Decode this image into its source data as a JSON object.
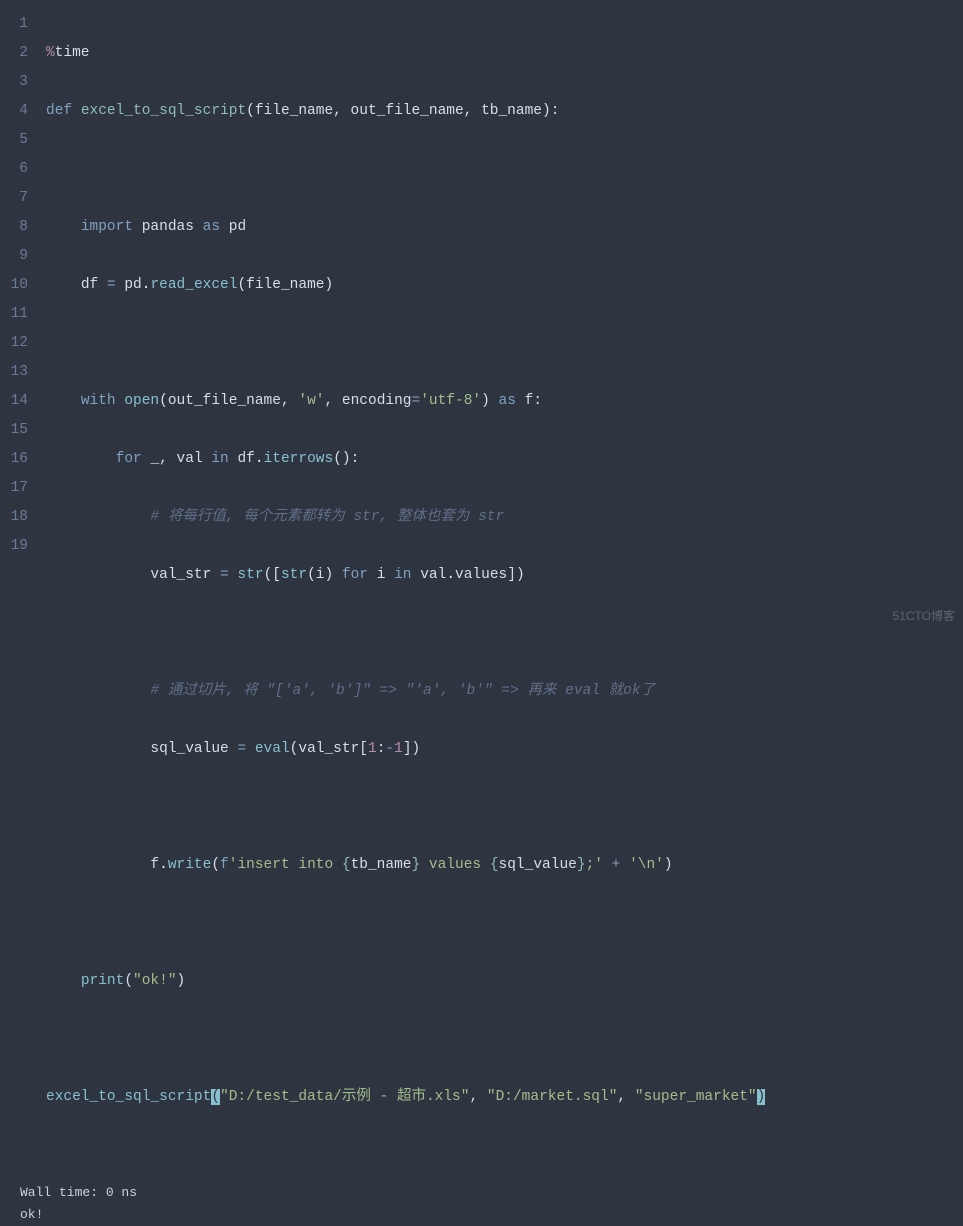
{
  "gutter": [
    "1",
    "2",
    "3",
    "4",
    "5",
    "6",
    "7",
    "8",
    "9",
    "10",
    "11",
    "12",
    "13",
    "14",
    "15",
    "16",
    "17",
    "18",
    "19"
  ],
  "code": {
    "l1_magic": "%",
    "l1_time": "time",
    "l2_def": "def",
    "l2_name": "excel_to_sql_script",
    "l2_params": "(file_name, out_file_name, tb_name):",
    "l4_import": "import",
    "l4_pandas": "pandas",
    "l4_as": "as",
    "l4_pd": "pd",
    "l5_df": "df",
    "l5_eq": "=",
    "l5_pd": "pd",
    "l5_dot": ".",
    "l5_read": "read_excel",
    "l5_arg": "(file_name)",
    "l7_with": "with",
    "l7_open": "open",
    "l7_args1": "(out_file_name, ",
    "l7_w": "'w'",
    "l7_comma": ", encoding",
    "l7_eq": "=",
    "l7_utf": "'utf-8'",
    "l7_close": ")",
    "l7_as": "as",
    "l7_f": "f:",
    "l8_for": "for",
    "l8_uscore": "_, val",
    "l8_in": "in",
    "l8_df": "df",
    "l8_dot": ".",
    "l8_iter": "iterrows",
    "l8_paren": "():",
    "l9_cmt": "# 将每行值, 每个元素都转为 str, 整体也套为 str",
    "l10_valstr": "val_str",
    "l10_eq": "=",
    "l10_str1": "str",
    "l10_b1": "([",
    "l10_str2": "str",
    "l10_b2": "(i)",
    "l10_for": "for",
    "l10_i": "i",
    "l10_in": "in",
    "l10_val": "val",
    "l10_dot": ".",
    "l10_values": "values])",
    "l12_cmt": "# 通过切片, 将 \"['a', 'b']\" => \"'a', 'b'\" => 再来 eval 就ok了",
    "l13_sqlv": "sql_value",
    "l13_eq": "=",
    "l13_eval": "eval",
    "l13_open": "(val_str[",
    "l13_n1": "1",
    "l13_colon": ":",
    "l13_neg": "-",
    "l13_n2": "1",
    "l13_close": "])",
    "l15_f": "f",
    "l15_dot": ".",
    "l15_write": "write",
    "l15_open": "(",
    "l15_fpre": "f",
    "l15_s1": "'insert into ",
    "l15_b1o": "{",
    "l15_tb": "tb_name",
    "l15_b1c": "}",
    "l15_s2": " values ",
    "l15_b2o": "{",
    "l15_sqv": "sql_value",
    "l15_b2c": "}",
    "l15_s3": ";'",
    "l15_plus": "+",
    "l15_nl": "'\\n'",
    "l15_close": ")",
    "l17_print": "print",
    "l17_open": "(",
    "l17_str": "\"ok!\"",
    "l17_close": ")",
    "l19_fn": "excel_to_sql_script",
    "l19_p0": "(",
    "l19_s1": "\"D:/test_data/示例 - 超市.xls\"",
    "l19_c1": ", ",
    "l19_s2": "\"D:/market.sql\"",
    "l19_c2": ", ",
    "l19_s3": "\"super_market\"",
    "l19_p1": ")"
  },
  "output": {
    "line1": "Wall time: 0 ns",
    "line2": "ok!"
  },
  "watermark": "51CTO博客"
}
